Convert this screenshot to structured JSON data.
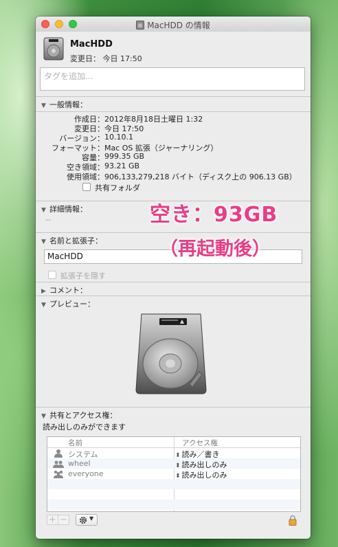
{
  "window": {
    "title": "MacHDD の情報"
  },
  "header": {
    "name": "MacHDD",
    "modified": "変更日： 今日 17:50",
    "tags_placeholder": "タグを追加..."
  },
  "general": {
    "heading": "一般情報：",
    "rows": [
      {
        "label": "作成日：",
        "value": "2012年8月18日土曜日 1:32"
      },
      {
        "label": "変更日：",
        "value": "今日 17:50"
      },
      {
        "label": "バージョン：",
        "value": "10.10.1"
      },
      {
        "label": "フォーマット：",
        "value": "Mac OS 拡張（ジャーナリング）"
      },
      {
        "label": "容量：",
        "value": "999.35 GB"
      },
      {
        "label": "空き領域：",
        "value": "93.21 GB"
      },
      {
        "label": "使用領域：",
        "value": "906,133,279,218 バイト（ディスク上の 906.13 GB）"
      }
    ],
    "shared_folder": "共有フォルダ"
  },
  "details": {
    "heading": "詳細情報：",
    "value": "--"
  },
  "name_ext": {
    "heading": "名前と拡張子：",
    "name_value": "MacHDD",
    "hide_ext": "拡張子を隠す"
  },
  "comments": {
    "heading": "コメント："
  },
  "preview": {
    "heading": "プレビュー："
  },
  "sharing": {
    "heading": "共有とアクセス権：",
    "note": "読み出しのみができます",
    "col_name": "名前",
    "col_access": "アクセス権",
    "rows": [
      {
        "name": "システム",
        "access": "読み／書き",
        "icon": "user-icon"
      },
      {
        "name": "wheel",
        "access": "読み出しのみ",
        "icon": "group-icon"
      },
      {
        "name": "everyone",
        "access": "読み出しのみ",
        "icon": "everyone-icon"
      }
    ],
    "add_label": "+",
    "remove_label": "−",
    "gear_icon": "gear-icon"
  },
  "annotation": {
    "line1": "空き：93GB",
    "line2": "（再起動後）"
  },
  "colors": {
    "annotation": "#ea3d86",
    "red": "#fc5f57",
    "yellow": "#fdbc2e",
    "green": "#33c748"
  }
}
